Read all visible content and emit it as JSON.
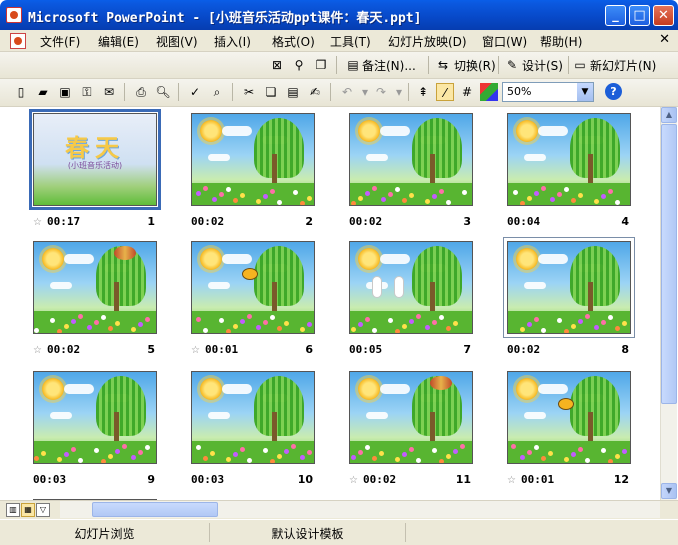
{
  "window": {
    "title": "Microsoft PowerPoint - [小班音乐活动ppt课件：春天.ppt]",
    "min_glyph": "_",
    "max_glyph": "□",
    "close_glyph": "✕"
  },
  "menu": {
    "items": [
      "文件(F)",
      "编辑(E)",
      "视图(V)",
      "插入(I)",
      "格式(O)",
      "工具(T)",
      "幻灯片放映(D)",
      "窗口(W)",
      "帮助(H)"
    ],
    "doc_close": "✕"
  },
  "toolbar_top": {
    "notes_label": "备注(N)...",
    "switch_label": "切换(R)",
    "design_label": "设计(S)",
    "new_slide_label": "新幻灯片(N)"
  },
  "toolbar_std": {
    "zoom": "50%",
    "help": "?"
  },
  "slides": [
    {
      "num": "1",
      "timing": "00:17",
      "has_star": true,
      "title_art": "春天",
      "sub_art": "(小班音乐活动)"
    },
    {
      "num": "2",
      "timing": "00:02",
      "has_star": false
    },
    {
      "num": "3",
      "timing": "00:02",
      "has_star": false
    },
    {
      "num": "4",
      "timing": "00:04",
      "has_star": false
    },
    {
      "num": "5",
      "timing": "00:02",
      "has_star": true
    },
    {
      "num": "6",
      "timing": "00:01",
      "has_star": true
    },
    {
      "num": "7",
      "timing": "00:05",
      "has_star": false
    },
    {
      "num": "8",
      "timing": "00:02",
      "has_star": false
    },
    {
      "num": "9",
      "timing": "00:03",
      "has_star": false
    },
    {
      "num": "10",
      "timing": "00:03",
      "has_star": false
    },
    {
      "num": "11",
      "timing": "00:02",
      "has_star": true
    },
    {
      "num": "12",
      "timing": "00:01",
      "has_star": true
    }
  ],
  "status": {
    "view": "幻灯片浏览",
    "template": "默认设计模板"
  },
  "colors": {
    "titlebar": "#0748c7",
    "chrome": "#ece9d8",
    "selection": "#3a6ab6"
  }
}
